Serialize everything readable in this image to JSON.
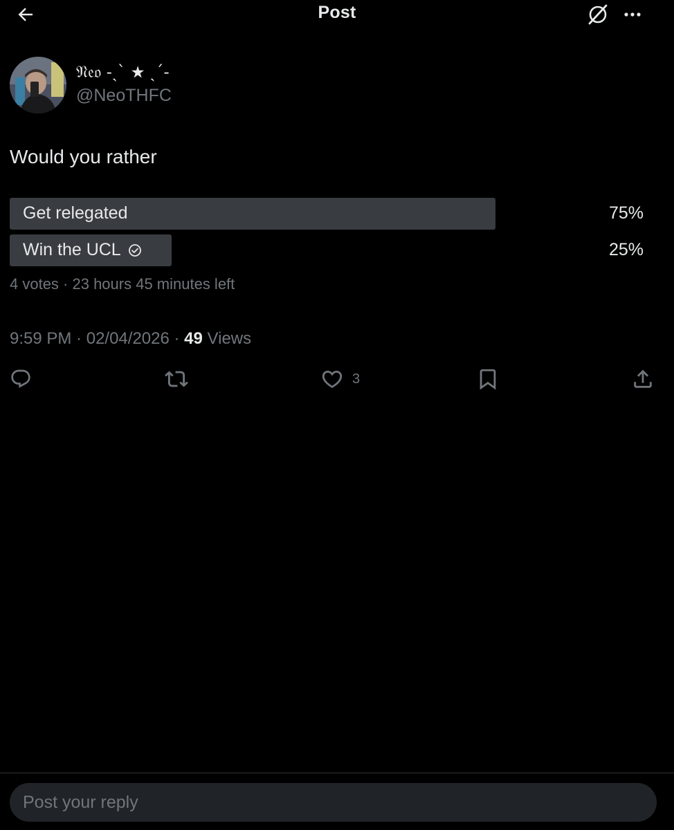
{
  "header": {
    "title": "Post",
    "back_icon": "arrow-left-icon",
    "grok_icon": "grok-icon",
    "more_icon": "more-horizontal-icon"
  },
  "author": {
    "display_name": "𝔑𝔢𝔬 -ˏˋ ★ ˎˊ-",
    "handle": "@NeoTHFC"
  },
  "tweet": {
    "text": "Would you rather"
  },
  "poll": {
    "options": [
      {
        "label": "Get relegated",
        "percent_text": "75%",
        "fill_fraction": 0.766,
        "selected": false
      },
      {
        "label": "Win the UCL",
        "percent_text": "25%",
        "fill_fraction": 0.256,
        "selected": true
      }
    ],
    "meta": "4 votes · 23 hours 45 minutes left"
  },
  "timestamp": {
    "time": "9:59 PM",
    "sep1": " · ",
    "date": "02/04/2026",
    "sep2": " · ",
    "views_count": "49",
    "views_label": " Views"
  },
  "actions": {
    "reply": {
      "icon": "reply-icon"
    },
    "repost": {
      "icon": "repost-icon"
    },
    "like": {
      "icon": "heart-icon",
      "count": "3"
    },
    "bookmark": {
      "icon": "bookmark-icon"
    },
    "share": {
      "icon": "share-icon"
    }
  },
  "reply_bar": {
    "placeholder": "Post your reply"
  },
  "colors": {
    "background": "#000000",
    "text_primary": "#e7e9ea",
    "text_secondary": "#71767b",
    "poll_fill": "#393c41",
    "reply_box": "#202327"
  }
}
